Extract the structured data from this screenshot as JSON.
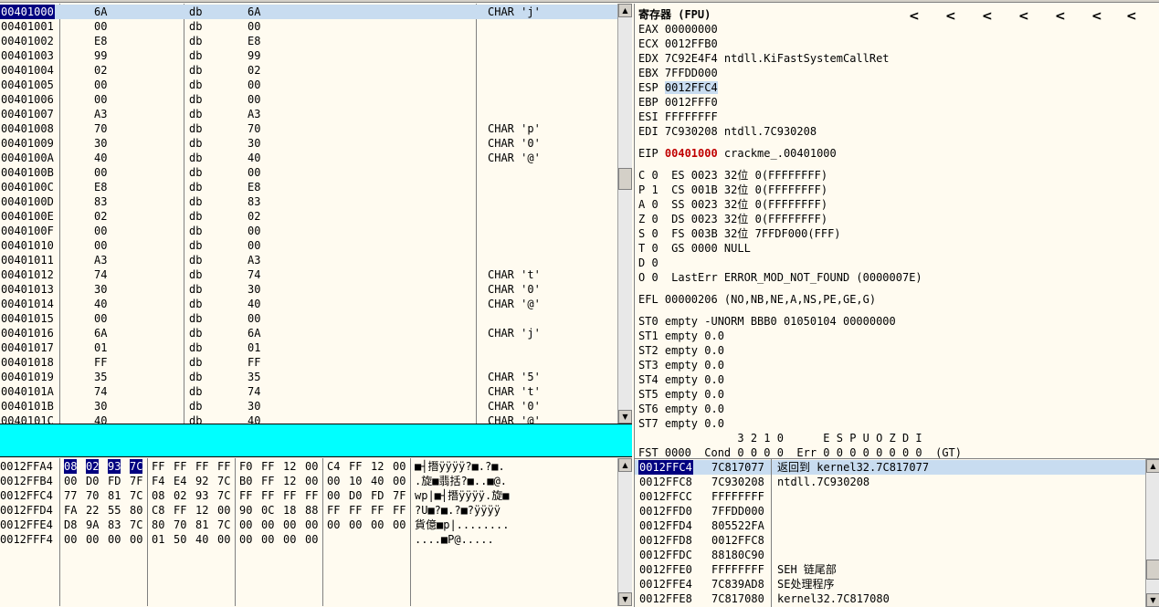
{
  "disasm": {
    "rows": [
      {
        "addr": "00401000",
        "hex": "6A",
        "op": "db",
        "arg": "6A",
        "comment": "CHAR 'j'"
      },
      {
        "addr": "00401001",
        "hex": "00",
        "op": "db",
        "arg": "00",
        "comment": ""
      },
      {
        "addr": "00401002",
        "hex": "E8",
        "op": "db",
        "arg": "E8",
        "comment": ""
      },
      {
        "addr": "00401003",
        "hex": "99",
        "op": "db",
        "arg": "99",
        "comment": ""
      },
      {
        "addr": "00401004",
        "hex": "02",
        "op": "db",
        "arg": "02",
        "comment": ""
      },
      {
        "addr": "00401005",
        "hex": "00",
        "op": "db",
        "arg": "00",
        "comment": ""
      },
      {
        "addr": "00401006",
        "hex": "00",
        "op": "db",
        "arg": "00",
        "comment": ""
      },
      {
        "addr": "00401007",
        "hex": "A3",
        "op": "db",
        "arg": "A3",
        "comment": ""
      },
      {
        "addr": "00401008",
        "hex": "70",
        "op": "db",
        "arg": "70",
        "comment": "CHAR 'p'"
      },
      {
        "addr": "00401009",
        "hex": "30",
        "op": "db",
        "arg": "30",
        "comment": "CHAR '0'"
      },
      {
        "addr": "0040100A",
        "hex": "40",
        "op": "db",
        "arg": "40",
        "comment": "CHAR '@'"
      },
      {
        "addr": "0040100B",
        "hex": "00",
        "op": "db",
        "arg": "00",
        "comment": ""
      },
      {
        "addr": "0040100C",
        "hex": "E8",
        "op": "db",
        "arg": "E8",
        "comment": ""
      },
      {
        "addr": "0040100D",
        "hex": "83",
        "op": "db",
        "arg": "83",
        "comment": ""
      },
      {
        "addr": "0040100E",
        "hex": "02",
        "op": "db",
        "arg": "02",
        "comment": ""
      },
      {
        "addr": "0040100F",
        "hex": "00",
        "op": "db",
        "arg": "00",
        "comment": ""
      },
      {
        "addr": "00401010",
        "hex": "00",
        "op": "db",
        "arg": "00",
        "comment": ""
      },
      {
        "addr": "00401011",
        "hex": "A3",
        "op": "db",
        "arg": "A3",
        "comment": ""
      },
      {
        "addr": "00401012",
        "hex": "74",
        "op": "db",
        "arg": "74",
        "comment": "CHAR 't'"
      },
      {
        "addr": "00401013",
        "hex": "30",
        "op": "db",
        "arg": "30",
        "comment": "CHAR '0'"
      },
      {
        "addr": "00401014",
        "hex": "40",
        "op": "db",
        "arg": "40",
        "comment": "CHAR '@'"
      },
      {
        "addr": "00401015",
        "hex": "00",
        "op": "db",
        "arg": "00",
        "comment": ""
      },
      {
        "addr": "00401016",
        "hex": "6A",
        "op": "db",
        "arg": "6A",
        "comment": "CHAR 'j'"
      },
      {
        "addr": "00401017",
        "hex": "01",
        "op": "db",
        "arg": "01",
        "comment": ""
      },
      {
        "addr": "00401018",
        "hex": "FF",
        "op": "db",
        "arg": "FF",
        "comment": ""
      },
      {
        "addr": "00401019",
        "hex": "35",
        "op": "db",
        "arg": "35",
        "comment": "CHAR '5'"
      },
      {
        "addr": "0040101A",
        "hex": "74",
        "op": "db",
        "arg": "74",
        "comment": "CHAR 't'"
      },
      {
        "addr": "0040101B",
        "hex": "30",
        "op": "db",
        "arg": "30",
        "comment": "CHAR '0'"
      },
      {
        "addr": "0040101C",
        "hex": "40",
        "op": "db",
        "arg": "40",
        "comment": "CHAR '@'"
      }
    ]
  },
  "registers": {
    "title": "寄存器 (FPU)",
    "nav_arrows": [
      "<",
      "<",
      "<",
      "<",
      "<",
      "<",
      "<"
    ],
    "lines": [
      {
        "pre": "EAX 00000000"
      },
      {
        "pre": "ECX 0012FFB0"
      },
      {
        "pre": "EDX 7C92E4F4 ntdll.KiFastSystemCallRet"
      },
      {
        "pre": "EBX 7FFDD000"
      },
      {
        "pre": "ESP ",
        "hl": "0012FFC4",
        "post": ""
      },
      {
        "pre": "EBP 0012FFF0"
      },
      {
        "pre": "ESI FFFFFFFF"
      },
      {
        "pre": "EDI 7C930208 ntdll.7C930208"
      },
      {
        "gap": true
      },
      {
        "pre": "EIP ",
        "red": "00401000",
        "post": " crackme_.00401000"
      },
      {
        "gap": true
      },
      {
        "pre": "C 0  ES 0023 32位 0(FFFFFFFF)"
      },
      {
        "pre": "P 1  CS 001B 32位 0(FFFFFFFF)"
      },
      {
        "pre": "A 0  SS 0023 32位 0(FFFFFFFF)"
      },
      {
        "pre": "Z 0  DS 0023 32位 0(FFFFFFFF)"
      },
      {
        "pre": "S 0  FS 003B 32位 7FFDF000(FFF)"
      },
      {
        "pre": "T 0  GS 0000 NULL"
      },
      {
        "pre": "D 0"
      },
      {
        "pre": "O 0  LastErr ERROR_MOD_NOT_FOUND (0000007E)"
      },
      {
        "gap": true
      },
      {
        "pre": "EFL 00000206 (NO,NB,NE,A,NS,PE,GE,G)"
      },
      {
        "gap": true
      },
      {
        "pre": "ST0 empty -UNORM BBB0 01050104 00000000"
      },
      {
        "pre": "ST1 empty 0.0"
      },
      {
        "pre": "ST2 empty 0.0"
      },
      {
        "pre": "ST3 empty 0.0"
      },
      {
        "pre": "ST4 empty 0.0"
      },
      {
        "pre": "ST5 empty 0.0"
      },
      {
        "pre": "ST6 empty 0.0"
      },
      {
        "pre": "ST7 empty 0.0"
      },
      {
        "pre": "               3 2 1 0      E S P U O Z D I"
      },
      {
        "pre": "FST 0000  Cond 0 0 0 0  Err 0 0 0 0 0 0 0 0  (GT)"
      }
    ]
  },
  "dump": {
    "rows": [
      {
        "addr": "0012FFA4",
        "b": [
          "08",
          "02",
          "93",
          "7C",
          "FF",
          "FF",
          "FF",
          "FF",
          "F0",
          "FF",
          "12",
          "00",
          "C4",
          "FF",
          "12",
          "00"
        ],
        "ascii": "■┤撍ÿÿÿÿ?■.?■."
      },
      {
        "addr": "0012FFB4",
        "b": [
          "00",
          "D0",
          "FD",
          "7F",
          "F4",
          "E4",
          "92",
          "7C",
          "B0",
          "FF",
          "12",
          "00",
          "00",
          "10",
          "40",
          "00"
        ],
        "ascii": ".旋■翡括?■..■@."
      },
      {
        "addr": "0012FFC4",
        "b": [
          "77",
          "70",
          "81",
          "7C",
          "08",
          "02",
          "93",
          "7C",
          "FF",
          "FF",
          "FF",
          "FF",
          "00",
          "D0",
          "FD",
          "7F"
        ],
        "ascii": "wp|■┤撍ÿÿÿÿ.旋■"
      },
      {
        "addr": "0012FFD4",
        "b": [
          "FA",
          "22",
          "55",
          "80",
          "C8",
          "FF",
          "12",
          "00",
          "90",
          "0C",
          "18",
          "88",
          "FF",
          "FF",
          "FF",
          "FF"
        ],
        "ascii": "?U■?■.?■?ÿÿÿÿ"
      },
      {
        "addr": "0012FFE4",
        "b": [
          "D8",
          "9A",
          "83",
          "7C",
          "80",
          "70",
          "81",
          "7C",
          "00",
          "00",
          "00",
          "00",
          "00",
          "00",
          "00",
          "00"
        ],
        "ascii": "貨億■p|........"
      },
      {
        "addr": "0012FFF4",
        "b": [
          "00",
          "00",
          "00",
          "00",
          "01",
          "50",
          "40",
          "00",
          "00",
          "00",
          "00",
          "00",
          "",
          "",
          "",
          ""
        ],
        "ascii": "....■P@....."
      }
    ]
  },
  "stack": {
    "rows": [
      {
        "addr": "0012FFC4",
        "val": "7C817077",
        "comment": "返回到 kernel32.7C817077"
      },
      {
        "addr": "0012FFC8",
        "val": "7C930208",
        "comment": "ntdll.7C930208"
      },
      {
        "addr": "0012FFCC",
        "val": "FFFFFFFF",
        "comment": ""
      },
      {
        "addr": "0012FFD0",
        "val": "7FFDD000",
        "comment": ""
      },
      {
        "addr": "0012FFD4",
        "val": "805522FA",
        "comment": ""
      },
      {
        "addr": "0012FFD8",
        "val": "0012FFC8",
        "comment": ""
      },
      {
        "addr": "0012FFDC",
        "val": "88180C90",
        "comment": ""
      },
      {
        "addr": "0012FFE0",
        "val": "FFFFFFFF",
        "comment": "SEH 链尾部"
      },
      {
        "addr": "0012FFE4",
        "val": "7C839AD8",
        "comment": "SE处理程序"
      },
      {
        "addr": "0012FFE8",
        "val": "7C817080",
        "comment": "kernel32.7C817080"
      }
    ]
  }
}
